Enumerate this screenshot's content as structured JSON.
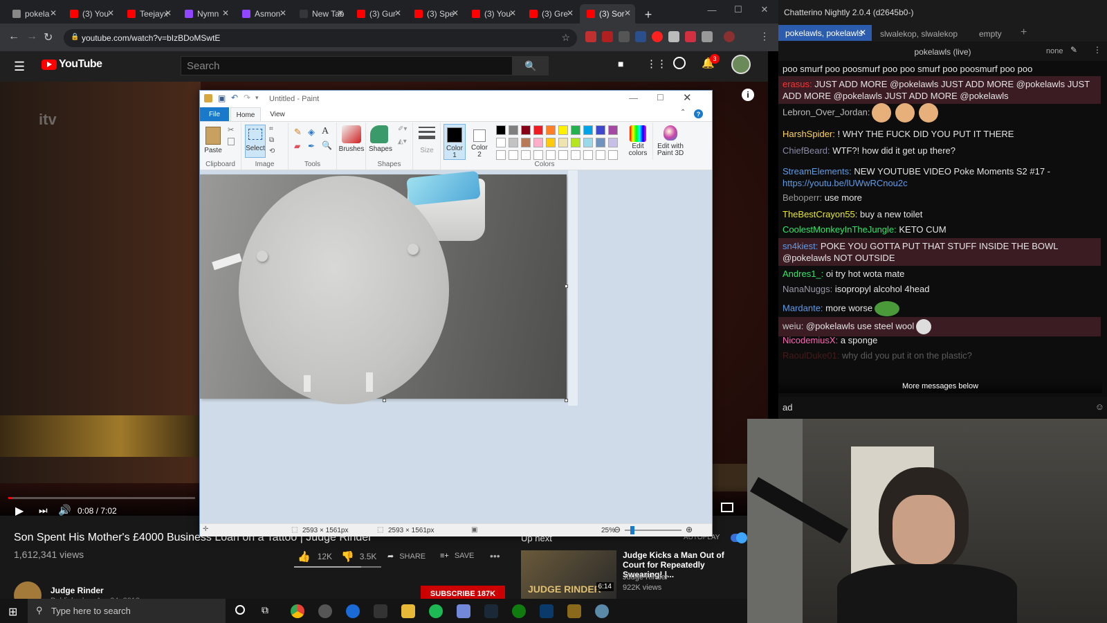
{
  "browser": {
    "tabs": [
      {
        "label": "pokela",
        "color": "#888888"
      },
      {
        "label": "(3) You",
        "color": "#ff0000"
      },
      {
        "label": "Teejayx",
        "color": "#ff0000"
      },
      {
        "label": "Nymn",
        "color": "#9146ff"
      },
      {
        "label": "Asmon",
        "color": "#9146ff"
      },
      {
        "label": "New Tab",
        "color": "#35363a"
      },
      {
        "label": "(3) Gur",
        "color": "#ff0000"
      },
      {
        "label": "(3) Spe",
        "color": "#ff0000"
      },
      {
        "label": "(3) You",
        "color": "#ff0000"
      },
      {
        "label": "(3) Gre",
        "color": "#ff0000"
      },
      {
        "label": "(3) Sor",
        "color": "#ff0000"
      }
    ],
    "url": "youtube.com/watch?v=bIzBDoMSwtE"
  },
  "youtube": {
    "logo": "YouTube",
    "search_placeholder": "Search",
    "notification_count": "3",
    "watermark": "itv",
    "time": "0:08 / 7:02",
    "title": "Son Spent His Mother's £4000 Business Loan on a Tattoo | Judge Rinder",
    "views": "1,612,341 views",
    "likes": "12K",
    "dislikes": "3.5K",
    "share": "SHARE",
    "save": "SAVE",
    "channel": "Judge Rinder",
    "published": "Published on Apr 24, 2018",
    "subscribe": "SUBSCRIBE 187K",
    "upnext": "Up next",
    "autoplay": "AUTOPLAY",
    "next_title": "Judge Kicks a Man Out of Court for Repeatedly Swearing! |...",
    "next_channel": "Judge Rinder",
    "next_views": "922K views",
    "next_duration": "6:14",
    "thumb_text": "JUDGE RINDER"
  },
  "paint": {
    "title": "Untitled - Paint",
    "tabs": [
      "File",
      "Home",
      "View"
    ],
    "paste": "Paste",
    "select": "Select",
    "brushes": "Brushes",
    "shapes": "Shapes",
    "size": "Size",
    "color1": "Color 1",
    "color2": "Color 2",
    "edit_colors": "Edit colors",
    "edit_3d": "Edit with Paint 3D",
    "groups": [
      "Clipboard",
      "Image",
      "Tools",
      "Shapes",
      "Colors"
    ],
    "dims1": "2593 × 1561px",
    "dims2": "2593 × 1561px",
    "zoom": "25%",
    "palette": [
      "#000000",
      "#7f7f7f",
      "#880015",
      "#ed1c24",
      "#ff7f27",
      "#fff200",
      "#22b14c",
      "#00a2e8",
      "#3f48cc",
      "#a349a4",
      "#ffffff",
      "#c3c3c3",
      "#b97a57",
      "#ffaec9",
      "#ffc90e",
      "#efe4b0",
      "#b5e61d",
      "#99d9ea",
      "#7092be",
      "#c8bfe7"
    ]
  },
  "chat": {
    "app_title": "Chatterino Nightly 2.0.4 (d2645b0-)",
    "tabs": [
      "pokelawls, pokelawls",
      "slwalekop, slwalekop",
      "empty"
    ],
    "channel": "pokelawls (live)",
    "mode": "none",
    "messages": [
      {
        "user": "",
        "ucolor": "#ffffff",
        "text": "poo smurf poo poosmurf poo poo smurf poo poosmurf poo poo",
        "hl": false
      },
      {
        "user": "erasus:",
        "ucolor": "#ff3333",
        "text": " JUST ADD MORE @pokelawls JUST ADD MORE @pokelawls JUST ADD MORE @pokelawls JUST ADD MORE @pokelawls",
        "hl": true
      },
      {
        "user": "Lebron_Over_Jordan:",
        "ucolor": "#bbbbbb",
        "text": "",
        "hl": false
      },
      {
        "user": "HarshSpider:",
        "ucolor": "#ffd65a",
        "text": " ! WHY THE FUCK DID YOU PUT IT THERE",
        "hl": false
      },
      {
        "user": "ChiefBeard:",
        "ucolor": "#8a8aa8",
        "text": " WTF?! how did it get up there?",
        "hl": false
      },
      {
        "user": "StreamElements:",
        "ucolor": "#5f9ce8",
        "text": " NEW YOUTUBE VIDEO  Poke Moments S2 #17 -",
        "hl": false
      },
      {
        "user": "Beboperr:",
        "ucolor": "#999999",
        "text": " use more",
        "hl": false
      },
      {
        "user": "TheBestCrayon55:",
        "ucolor": "#e7e72e",
        "text": " buy a new toilet",
        "hl": false
      },
      {
        "user": "CoolestMonkeyInTheJungle:",
        "ucolor": "#2ee86b",
        "text": " KETO CUM",
        "hl": false
      },
      {
        "user": "sn4kiest:",
        "ucolor": "#5f9ce8",
        "text": " POKE YOU GOTTA PUT THAT STUFF INSIDE THE BOWL @pokelawls NOT OUTSIDE",
        "hl": true
      },
      {
        "user": "Andres1_:",
        "ucolor": "#2ee86b",
        "text": " oi try hot wota mate",
        "hl": false
      },
      {
        "user": "NanaNuggs:",
        "ucolor": "#9a9aa8",
        "text": " isopropyl alcohol 4head",
        "hl": false
      },
      {
        "user": "Mardante:",
        "ucolor": "#5f9ce8",
        "text": " more worse",
        "hl": false
      },
      {
        "user": "weiu:",
        "ucolor": "#cccccc",
        "text": " @pokelawls use steel wool",
        "hl": true
      },
      {
        "user": "NicodemiusX:",
        "ucolor": "#ff69b4",
        "text": " a sponge",
        "hl": false
      },
      {
        "user": "RaoulDuke01:",
        "ucolor": "#b03030",
        "text": " why did you put it on the plastic?",
        "hl": false
      }
    ],
    "link": "https://youtu.be/lUWwRCnou2c",
    "more_below": "More messages below",
    "input": "ad"
  },
  "taskbar": {
    "search": "Type here to search"
  }
}
